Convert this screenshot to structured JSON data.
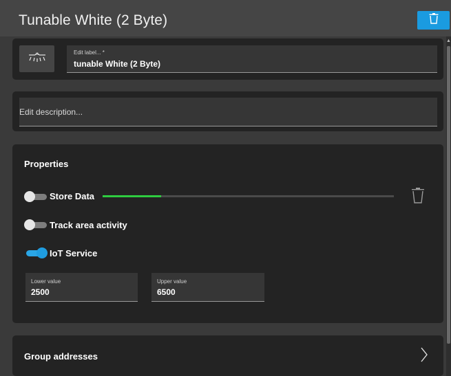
{
  "header": {
    "title": "Tunable White (2 Byte)",
    "delete_icon": "trash-icon",
    "delete_color": "#1a9be0"
  },
  "label_panel": {
    "icon": "tunable-white-light-icon",
    "field_label": "Edit label... *",
    "field_value": "tunable White (2 Byte)"
  },
  "description_panel": {
    "placeholder": "Edit description..."
  },
  "properties": {
    "title": "Properties",
    "store_data": {
      "label": "Store Data",
      "enabled": false,
      "progress_fraction": 0.2,
      "progress_color": "#2ecc40"
    },
    "track_area_activity": {
      "label": "Track area activity",
      "enabled": false
    },
    "iot_service": {
      "label": "IoT Service",
      "enabled": true
    },
    "lower": {
      "label": "Lower value",
      "value": "2500"
    },
    "separator": "-",
    "upper": {
      "label": "Upper value",
      "value": "6500"
    }
  },
  "group_addresses": {
    "title": "Group addresses",
    "chevron_icon": "chevron-right-icon"
  }
}
